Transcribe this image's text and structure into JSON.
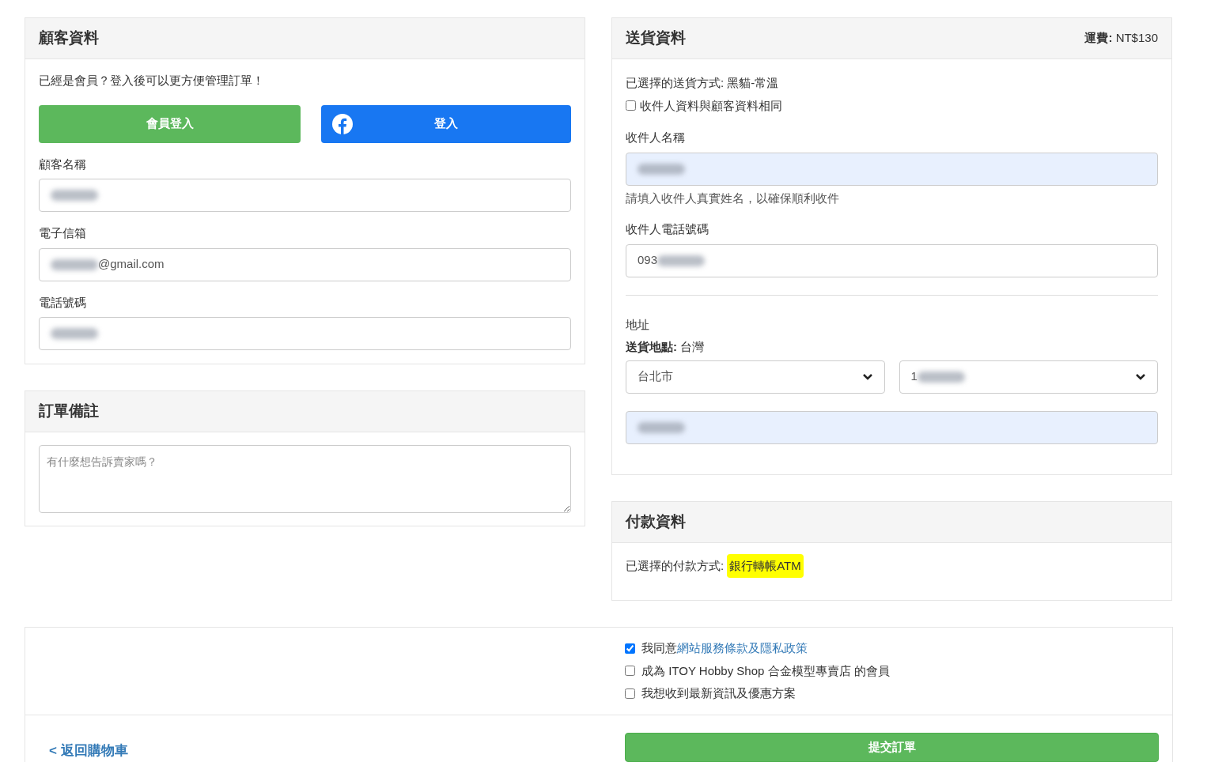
{
  "customer": {
    "title": "顧客資料",
    "prompt": "已經是會員？登入後可以更方便管理訂單！",
    "member_login": "會員登入",
    "facebook_login": "登入",
    "fields": [
      {
        "label": "顧客名稱",
        "blurred_before": true
      },
      {
        "label": "電子信箱",
        "value": "@gmail.com",
        "blurred_before": true
      },
      {
        "label": "電話號碼",
        "blurred_before": true
      }
    ]
  },
  "notes": {
    "title": "訂單備註",
    "placeholder": "有什麼想告訴賣家嗎？"
  },
  "shipping": {
    "title": "送貨資料",
    "fee_label": "運費:",
    "fee": "NT$130",
    "method_label": "已選擇的送貨方式:",
    "method": "黑貓-常溫",
    "same_as_customer": {
      "label": "收件人資料與顧客資料相同",
      "checked": false
    },
    "recipient_name": {
      "label": "收件人名稱",
      "blurred_before": true,
      "autofilled": true,
      "hint": "請填入收件人真實姓名，以確保順利收件"
    },
    "recipient_phone": {
      "label": "收件人電話號碼",
      "value": "093",
      "blurred_after": true,
      "autofilled": false
    },
    "address_label": "地址",
    "location_label": "送貨地點:",
    "location": "台灣",
    "city": "台北市",
    "district": {
      "value": "1",
      "blurred_after": true
    },
    "street": {
      "blurred_before": true,
      "autofilled": true
    }
  },
  "payment": {
    "title": "付款資料",
    "method_label": "已選擇的付款方式:",
    "method": "銀行轉帳ATM",
    "highlighted": true
  },
  "agreements": [
    {
      "text": "我同意",
      "link": "網站服務條款及隱私政策",
      "checked": true
    },
    {
      "text": "成為 ITOY Hobby Shop 合金模型專賣店 的會員",
      "checked": false
    },
    {
      "text": "我想收到最新資訊及優惠方案",
      "checked": false
    }
  ],
  "back_link": "< 返回購物車",
  "submit": "提交訂單"
}
